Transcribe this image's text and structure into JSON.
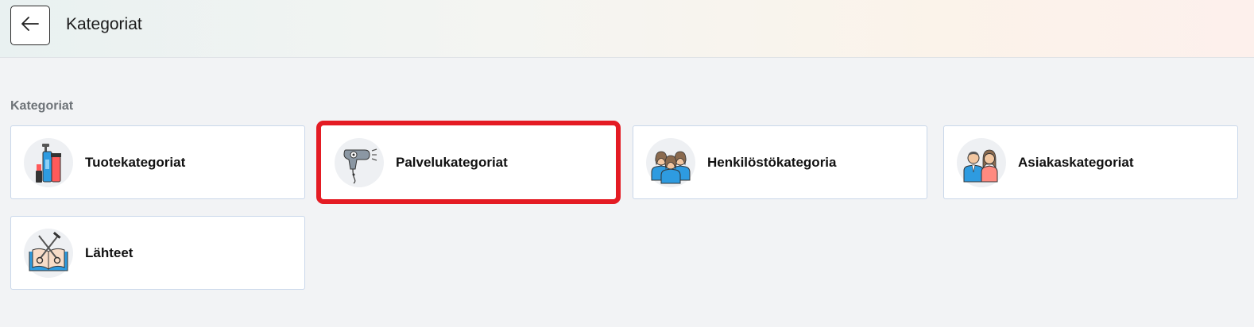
{
  "header": {
    "title": "Kategoriat",
    "back_icon": "arrow-left-icon"
  },
  "section": {
    "label": "Kategoriat"
  },
  "cards": [
    {
      "label": "Tuotekategoriat",
      "icon": "cosmetics-products-icon"
    },
    {
      "label": "Palvelukategoriat",
      "icon": "hair-dryer-icon",
      "highlighted": true
    },
    {
      "label": "Henkilöstökategoria",
      "icon": "staff-group-icon"
    },
    {
      "label": "Asiakaskategoriat",
      "icon": "customers-couple-icon"
    },
    {
      "label": "Lähteet",
      "icon": "book-scissors-icon"
    }
  ],
  "colors": {
    "highlight": "#e41b23",
    "card_border": "#c9d7ea",
    "background": "#f2f3f5"
  }
}
